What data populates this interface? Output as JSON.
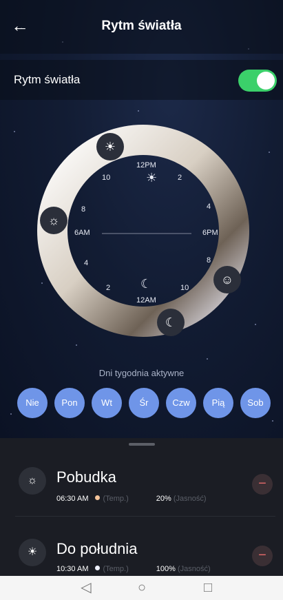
{
  "header": {
    "title": "Rytm światła",
    "back_icon": "arrow-left-icon"
  },
  "toggle": {
    "label": "Rytm światła",
    "enabled": true,
    "color": "#3bd06a"
  },
  "dial": {
    "labels": {
      "top": "12PM",
      "bottom": "12AM",
      "left": "6AM",
      "right": "6PM",
      "n10a": "10",
      "n2a": "2",
      "n8a": "8",
      "n4a": "4",
      "n4b": "4",
      "n8b": "8",
      "n2b": "2",
      "n10b": "10"
    },
    "markers": [
      {
        "name": "sun",
        "glyph": "☀"
      },
      {
        "name": "sunrise",
        "glyph": "☼"
      },
      {
        "name": "smile",
        "glyph": "☺"
      },
      {
        "name": "moon",
        "glyph": "☾"
      }
    ]
  },
  "days": {
    "title": "Dni tygodnia aktywne",
    "items": [
      "Nie",
      "Pon",
      "Wt",
      "Śr",
      "Czw",
      "Pią",
      "Sob"
    ],
    "color": "#6f95e8"
  },
  "schedule": [
    {
      "title": "Pobudka",
      "time": "06:30 AM",
      "temp_label": "(Temp.)",
      "temp_color": "#f4c49a",
      "brightness": "20%",
      "brightness_label": "(Jasność)"
    },
    {
      "title": "Do południa",
      "time": "10:30 AM",
      "temp_label": "(Temp.)",
      "temp_color": "#eef1ff",
      "brightness": "100%",
      "brightness_label": "(Jasność)"
    }
  ],
  "navbar": {
    "back": "◁",
    "home": "○",
    "recent": "□"
  }
}
